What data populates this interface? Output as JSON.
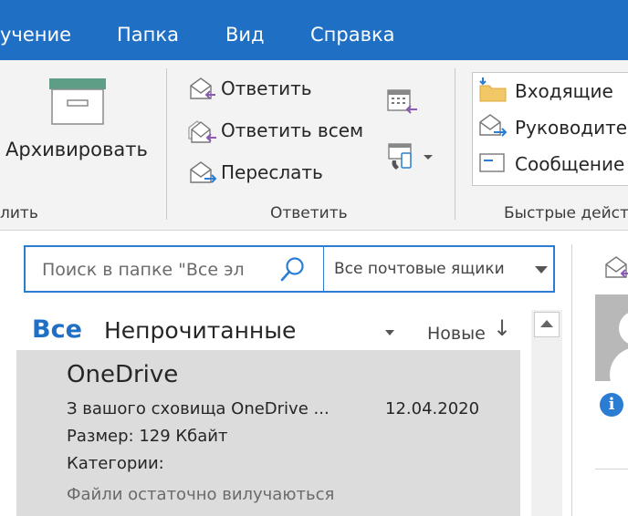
{
  "tabs": [
    {
      "label": "учение"
    },
    {
      "label": "Папка"
    },
    {
      "label": "Вид"
    },
    {
      "label": "Справка"
    }
  ],
  "ribbon": {
    "delete_group": {
      "archive_label": "Архивировать",
      "group_label": "лить"
    },
    "respond_group": {
      "reply_label": "Ответить",
      "reply_all_label": "Ответить всем",
      "forward_label": "Переслать",
      "group_label": "Ответить"
    },
    "quick_steps": {
      "items": [
        {
          "label": "Входящие",
          "icon": "folder-move-icon"
        },
        {
          "label": "Руководите",
          "icon": "envelope-forward-icon"
        },
        {
          "label": "Сообщение",
          "icon": "envelope-icon"
        }
      ],
      "group_label": "Быстрые дейст"
    }
  },
  "search": {
    "placeholder": "Поиск в папке \"Все эл",
    "scope": "Все почтовые ящики"
  },
  "filters": {
    "all": "Все",
    "unread": "Непрочитанные",
    "sort": "Новые",
    "sort_arrow": "↓"
  },
  "message": {
    "sender": "OneDrive",
    "subject": "З вашого сховища OneDrive ...",
    "date": "12.04.2020",
    "size": "Размер: 129 Кбайт",
    "categories": "Категории:",
    "preview": "Файли остаточно вилучаються"
  },
  "colors": {
    "accent": "#1f6fc5",
    "selected_row": "#dcdcdc",
    "ribbon_bg": "#f3f3f3"
  }
}
